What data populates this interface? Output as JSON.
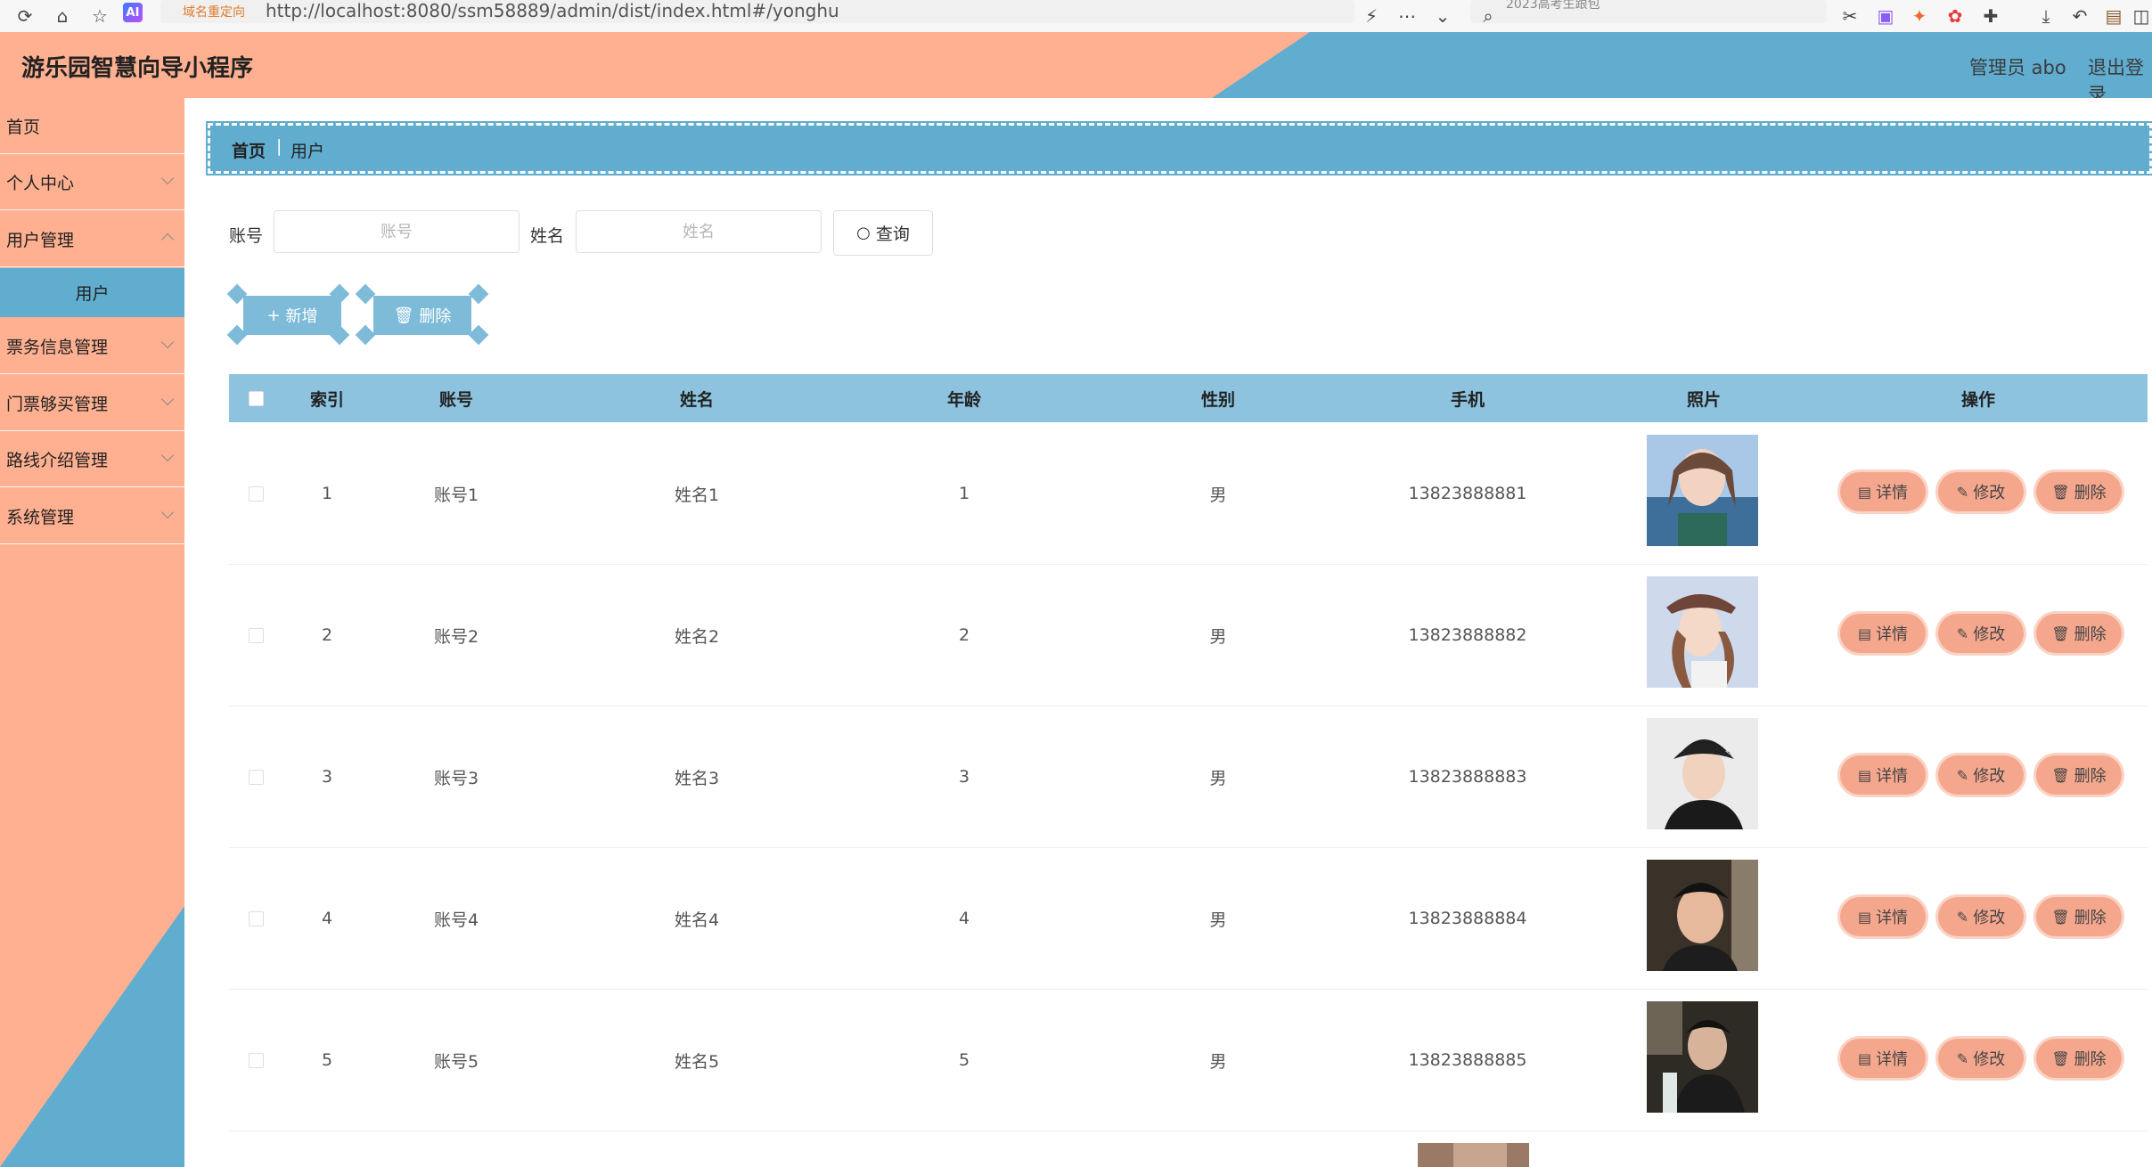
{
  "browser": {
    "redirect_tag": "域名重定向",
    "url": "http://localhost:8080/ssm58889/admin/dist/index.html#/yonghu",
    "search_text": "2023高考生跟包",
    "ai_badge": "AI"
  },
  "header": {
    "title": "游乐园智慧向导小程序",
    "admin": "管理员 abo",
    "logout": "退出登录"
  },
  "sidebar": {
    "items": [
      {
        "label": "首页"
      },
      {
        "label": "个人中心"
      },
      {
        "label": "用户管理"
      },
      {
        "label": "票务信息管理"
      },
      {
        "label": "门票够买管理"
      },
      {
        "label": "路线介绍管理"
      },
      {
        "label": "系统管理"
      }
    ],
    "sub_item": "用户"
  },
  "breadcrumb": {
    "home": "首页",
    "separator": "|",
    "current": "用户"
  },
  "search": {
    "account_label": "账号",
    "account_placeholder": "账号",
    "name_label": "姓名",
    "name_placeholder": "姓名",
    "query_button": "查询"
  },
  "actions": {
    "add": "新增",
    "delete": "删除"
  },
  "table": {
    "headers": [
      "索引",
      "账号",
      "姓名",
      "年龄",
      "性别",
      "手机",
      "照片",
      "操作"
    ],
    "rows": [
      {
        "index": "1",
        "account": "账号1",
        "name": "姓名1",
        "age": "1",
        "gender": "男",
        "phone": "13823888881"
      },
      {
        "index": "2",
        "account": "账号2",
        "name": "姓名2",
        "age": "2",
        "gender": "男",
        "phone": "13823888882"
      },
      {
        "index": "3",
        "account": "账号3",
        "name": "姓名3",
        "age": "3",
        "gender": "男",
        "phone": "13823888883"
      },
      {
        "index": "4",
        "account": "账号4",
        "name": "姓名4",
        "age": "4",
        "gender": "男",
        "phone": "13823888884"
      },
      {
        "index": "5",
        "account": "账号5",
        "name": "姓名5",
        "age": "5",
        "gender": "男",
        "phone": "13823888885"
      }
    ],
    "op_labels": {
      "detail": "详情",
      "edit": "修改",
      "delete": "删除"
    }
  },
  "colors": {
    "salmon": "#ffb091",
    "blue": "#60add0",
    "table_head": "#8dc3df",
    "op_button": "#f5a78e"
  }
}
